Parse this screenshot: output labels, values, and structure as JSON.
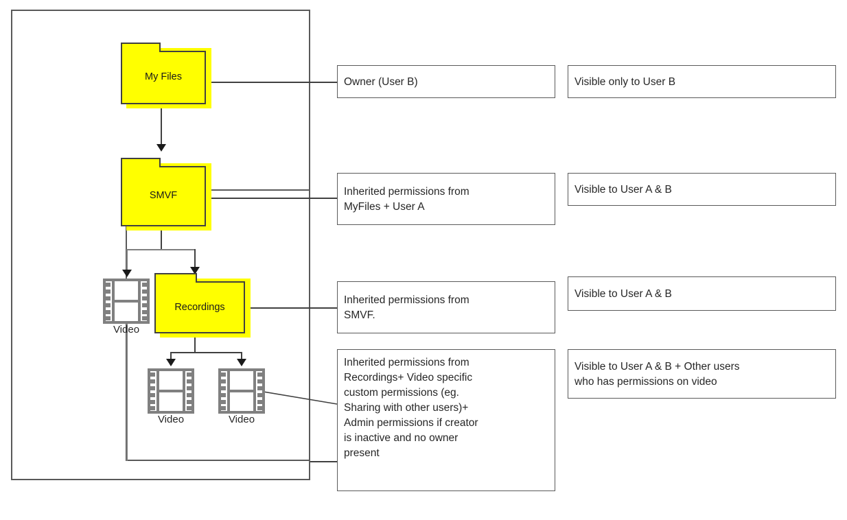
{
  "diagram": {
    "title": "Folder permission inheritance diagram",
    "colors": {
      "folder_fill": "#ffff00",
      "folder_border": "#404040",
      "box_border": "#595959",
      "line": "#404040",
      "film_frame": "#808080",
      "text": "#262626"
    }
  },
  "nodes": {
    "my_files": {
      "label": "My Files",
      "type": "folder"
    },
    "smvf": {
      "label": "SMVF",
      "type": "folder"
    },
    "recordings": {
      "label": "Recordings",
      "type": "folder"
    },
    "video_1": {
      "label": "Video",
      "type": "video-file"
    },
    "video_2": {
      "label": "Video",
      "type": "video-file"
    },
    "video_3": {
      "label": "Video",
      "type": "video-file"
    }
  },
  "permission_callouts": [
    {
      "id": "owner",
      "text": "Owner (User B)"
    },
    {
      "id": "smvf-perms",
      "text": "Inherited permissions from\nMyFiles + User A"
    },
    {
      "id": "recordings-perms",
      "text": "Inherited permissions from\nSMVF."
    },
    {
      "id": "video-perms",
      "text": "Inherited permissions from\nRecordings+ Video specific\ncustom permissions (eg.\nSharing with other users)+\nAdmin permissions if creator\nis inactive and no owner\npresent"
    }
  ],
  "visibility_callouts": [
    {
      "id": "vis-owner",
      "text": "Visible only to User B"
    },
    {
      "id": "vis-smvf",
      "text": "Visible to User A & B"
    },
    {
      "id": "vis-recordings",
      "text": "Visible to User A & B"
    },
    {
      "id": "vis-video",
      "text": "Visible to User A & B + Other users\nwho has permissions on video"
    }
  ]
}
